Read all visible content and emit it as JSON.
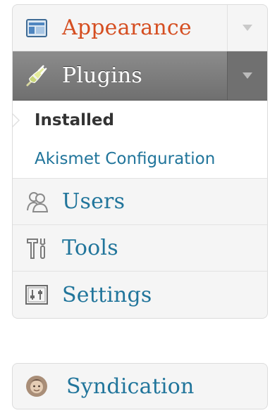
{
  "menu": {
    "appearance": {
      "label": "Appearance",
      "icon": "appearance-icon"
    },
    "plugins": {
      "label": "Plugins",
      "icon": "plugin-icon",
      "submenu": [
        {
          "label": "Installed",
          "current": true
        },
        {
          "label": "Akismet Configuration",
          "current": false
        }
      ]
    },
    "users": {
      "label": "Users",
      "icon": "users-icon"
    },
    "tools": {
      "label": "Tools",
      "icon": "tools-icon"
    },
    "settings": {
      "label": "Settings",
      "icon": "settings-icon"
    }
  },
  "menu2": {
    "syndication": {
      "label": "Syndication",
      "icon": "syndication-avatar-icon"
    }
  },
  "colors": {
    "link": "#21759b",
    "active_link": "#d54e21",
    "plugins_header": "#777777",
    "current_text": "#333333"
  }
}
